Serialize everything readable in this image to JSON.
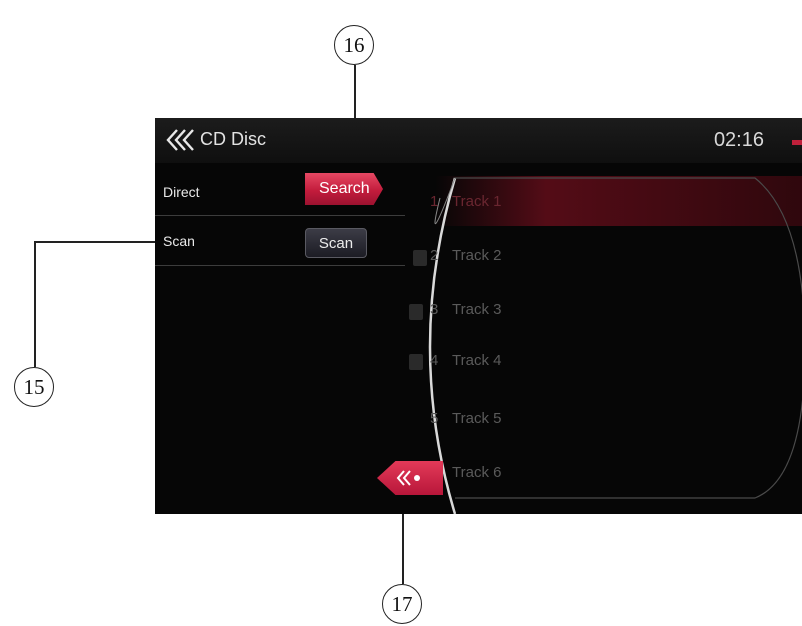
{
  "callouts": {
    "c15": "15",
    "c16": "16",
    "c17": "17"
  },
  "header": {
    "title": "CD Disc",
    "clock": "02:16",
    "accent": "#c0203b"
  },
  "left_panel": {
    "rows": [
      {
        "label": "Direct",
        "button": "Search"
      },
      {
        "label": "Scan",
        "button": "Scan"
      }
    ]
  },
  "tracks": [
    {
      "number": "1",
      "label": "Track 1",
      "selected": true
    },
    {
      "number": "2",
      "label": "Track 2"
    },
    {
      "number": "3",
      "label": "Track 3"
    },
    {
      "number": "4",
      "label": "Track 4"
    },
    {
      "number": "5",
      "label": "Track 5"
    },
    {
      "number": "",
      "label": "Track 6"
    }
  ],
  "icons": {
    "back": "triple-chevron-left-icon",
    "eject": "eject-chevron-icon",
    "disc": "cd-track-icon"
  }
}
